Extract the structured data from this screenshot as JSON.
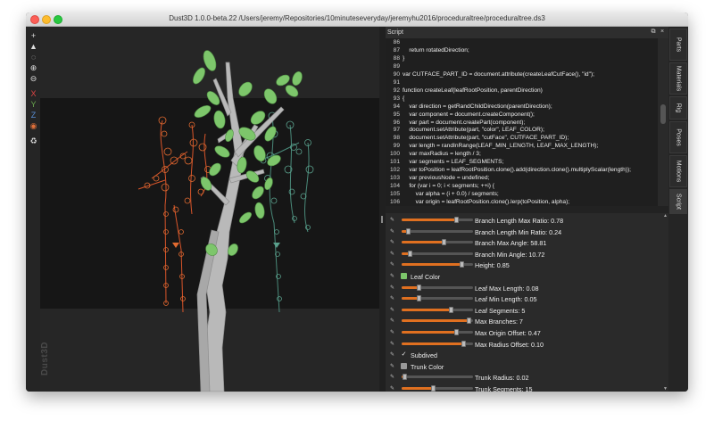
{
  "window": {
    "title": "Dust3D 1.0.0-beta.22 /Users/jeremy/Repositories/10minuteseveryday/jeremyhu2016/proceduraltree/proceduraltree.ds3",
    "watermark": "Dust3D"
  },
  "colors": {
    "accent": "#e07020",
    "leaf": "#7dc66b",
    "trunk": "#bdbdbd",
    "window_bg": "#262626"
  },
  "toolbar": {
    "items": [
      {
        "name": "add-icon",
        "glyph": "+",
        "color": "#dddddd"
      },
      {
        "name": "select-arrow-icon",
        "glyph": "▲",
        "color": "#dddddd"
      },
      {
        "name": "lasso-icon",
        "glyph": "◌",
        "color": "#dddddd"
      },
      {
        "name": "zoom-in-icon",
        "glyph": "⊕",
        "color": "#dddddd"
      },
      {
        "name": "zoom-out-icon",
        "glyph": "⊖",
        "color": "#dddddd"
      },
      {
        "name": "x-axis-lock-icon",
        "glyph": "X",
        "color": "#e04545"
      },
      {
        "name": "y-axis-lock-icon",
        "glyph": "Y",
        "color": "#6aa84f"
      },
      {
        "name": "z-axis-lock-icon",
        "glyph": "Z",
        "color": "#5a8fd8"
      },
      {
        "name": "radius-lock-icon",
        "glyph": "◉",
        "color": "#e0703a"
      },
      {
        "name": "regenerate-icon",
        "glyph": "♻",
        "color": "#dddddd"
      }
    ]
  },
  "script_panel": {
    "title": "Script",
    "code_lines": [
      {
        "num": "86",
        "text": ""
      },
      {
        "num": "87",
        "text": "    return rotatedDirection;"
      },
      {
        "num": "88",
        "text": "}"
      },
      {
        "num": "89",
        "text": ""
      },
      {
        "num": "90",
        "text": "var CUTFACE_PART_ID = document.attribute(createLeafCutFace(), \"id\");"
      },
      {
        "num": "91",
        "text": ""
      },
      {
        "num": "92",
        "text": "function createLeaf(leafRootPosition, parentDirection)"
      },
      {
        "num": "93",
        "text": "{"
      },
      {
        "num": "94",
        "text": "    var direction = getRandChildDirection(parentDirection);"
      },
      {
        "num": "95",
        "text": "    var component = document.createComponent();"
      },
      {
        "num": "96",
        "text": "    var part = document.createPart(component);"
      },
      {
        "num": "97",
        "text": "    document.setAttribute(part, \"color\", LEAF_COLOR);"
      },
      {
        "num": "98",
        "text": "    document.setAttribute(part, \"cutFace\", CUTFACE_PART_ID);"
      },
      {
        "num": "99",
        "text": "    var length = randInRange(LEAF_MIN_LENGTH, LEAF_MAX_LENGTH);"
      },
      {
        "num": "100",
        "text": "    var maxRadius = length / 3;"
      },
      {
        "num": "101",
        "text": "    var segments = LEAF_SEGMENTS;"
      },
      {
        "num": "102",
        "text": "    var toPosition = leafRootPosition.clone().add(direction.clone().multiplyScalar(length));"
      },
      {
        "num": "103",
        "text": "    var previousNode = undefined;"
      },
      {
        "num": "104",
        "text": "    for (var i = 0; i < segments; ++i) {"
      },
      {
        "num": "105",
        "text": "        var alpha = (i + 0.0) / segments;"
      },
      {
        "num": "106",
        "text": "        var origin = leafRootPosition.clone().lerp(toPosition, alpha);"
      }
    ],
    "params": [
      {
        "kind": "slider",
        "label": "Branch Length Max Ratio: 0.78",
        "value": 0.78
      },
      {
        "kind": "slider",
        "label": "Branch Length Min Ratio: 0.24",
        "value": 0.1
      },
      {
        "kind": "slider",
        "label": "Branch Max Angle: 58.81",
        "value": 0.6
      },
      {
        "kind": "slider",
        "label": "Branch Min Angle: 10.72",
        "value": 0.12
      },
      {
        "kind": "slider",
        "label": "Height: 0.85",
        "value": 0.85
      },
      {
        "kind": "color",
        "label": "Leaf Color",
        "color": "#7dc66b"
      },
      {
        "kind": "slider",
        "label": "Leaf Max Length: 0.08",
        "value": 0.25
      },
      {
        "kind": "slider",
        "label": "Leaf Min Length: 0.05",
        "value": 0.25
      },
      {
        "kind": "slider",
        "label": "Leaf Segments: 5",
        "value": 0.7
      },
      {
        "kind": "slider",
        "label": "Max Branches: 7",
        "value": 0.95
      },
      {
        "kind": "slider",
        "label": "Max Origin Offset: 0.47",
        "value": 0.78
      },
      {
        "kind": "slider",
        "label": "Max Radius Offset: 0.10",
        "value": 0.88
      },
      {
        "kind": "check",
        "label": "Subdived",
        "glyph": "✓"
      },
      {
        "kind": "color",
        "label": "Trunk Color",
        "color": "#9a9a9a"
      },
      {
        "kind": "slider",
        "label": "Trunk Radius: 0.02",
        "value": 0.05
      },
      {
        "kind": "slider",
        "label": "Trunk Segments: 15",
        "value": 0.45
      }
    ]
  },
  "side_tabs": [
    {
      "label": "Parts"
    },
    {
      "label": "Materials"
    },
    {
      "label": "Rig"
    },
    {
      "label": "Poses"
    },
    {
      "label": "Motions"
    },
    {
      "label": "Script"
    }
  ]
}
